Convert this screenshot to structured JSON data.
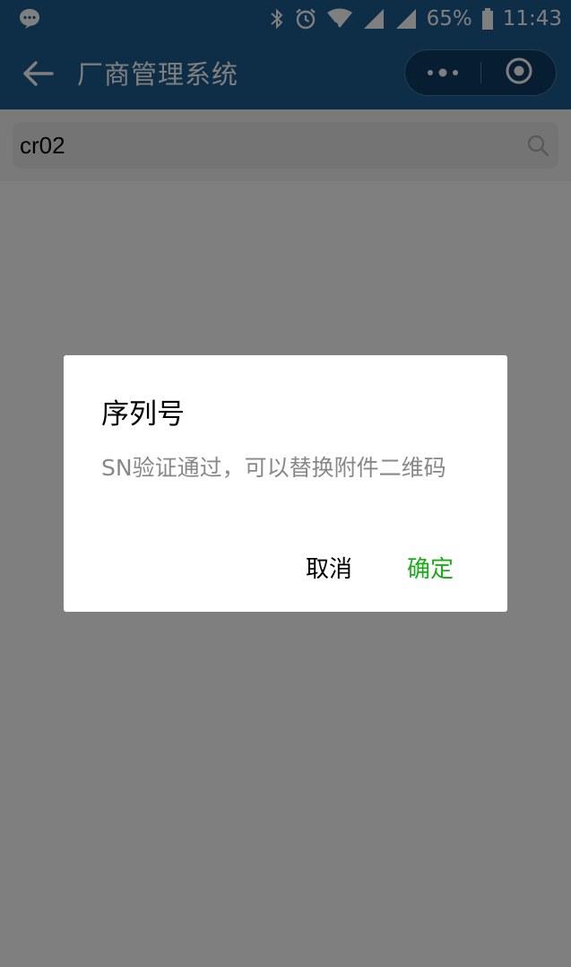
{
  "status_bar": {
    "battery_percent": "65%",
    "time": "11:43",
    "icons": [
      "chat-bubble-icon",
      "bluetooth-icon",
      "alarm-icon",
      "wifi-icon",
      "signal-icon",
      "signal-icon",
      "battery-icon"
    ]
  },
  "nav": {
    "title": "厂商管理系统",
    "back_icon": "arrow-left-icon",
    "capsule_icons": [
      "more-dots-icon",
      "close-circle-icon"
    ]
  },
  "search": {
    "value": "cr02",
    "icon": "search-icon"
  },
  "dialog": {
    "title": "序列号",
    "content": "SN验证通过，可以替换附件二维码",
    "cancel_label": "取消",
    "confirm_label": "确定"
  },
  "colors": {
    "header_bg": "#1d5a8f",
    "confirm_green": "#1aad19",
    "mask": "rgba(0,0,0,0.5)"
  }
}
